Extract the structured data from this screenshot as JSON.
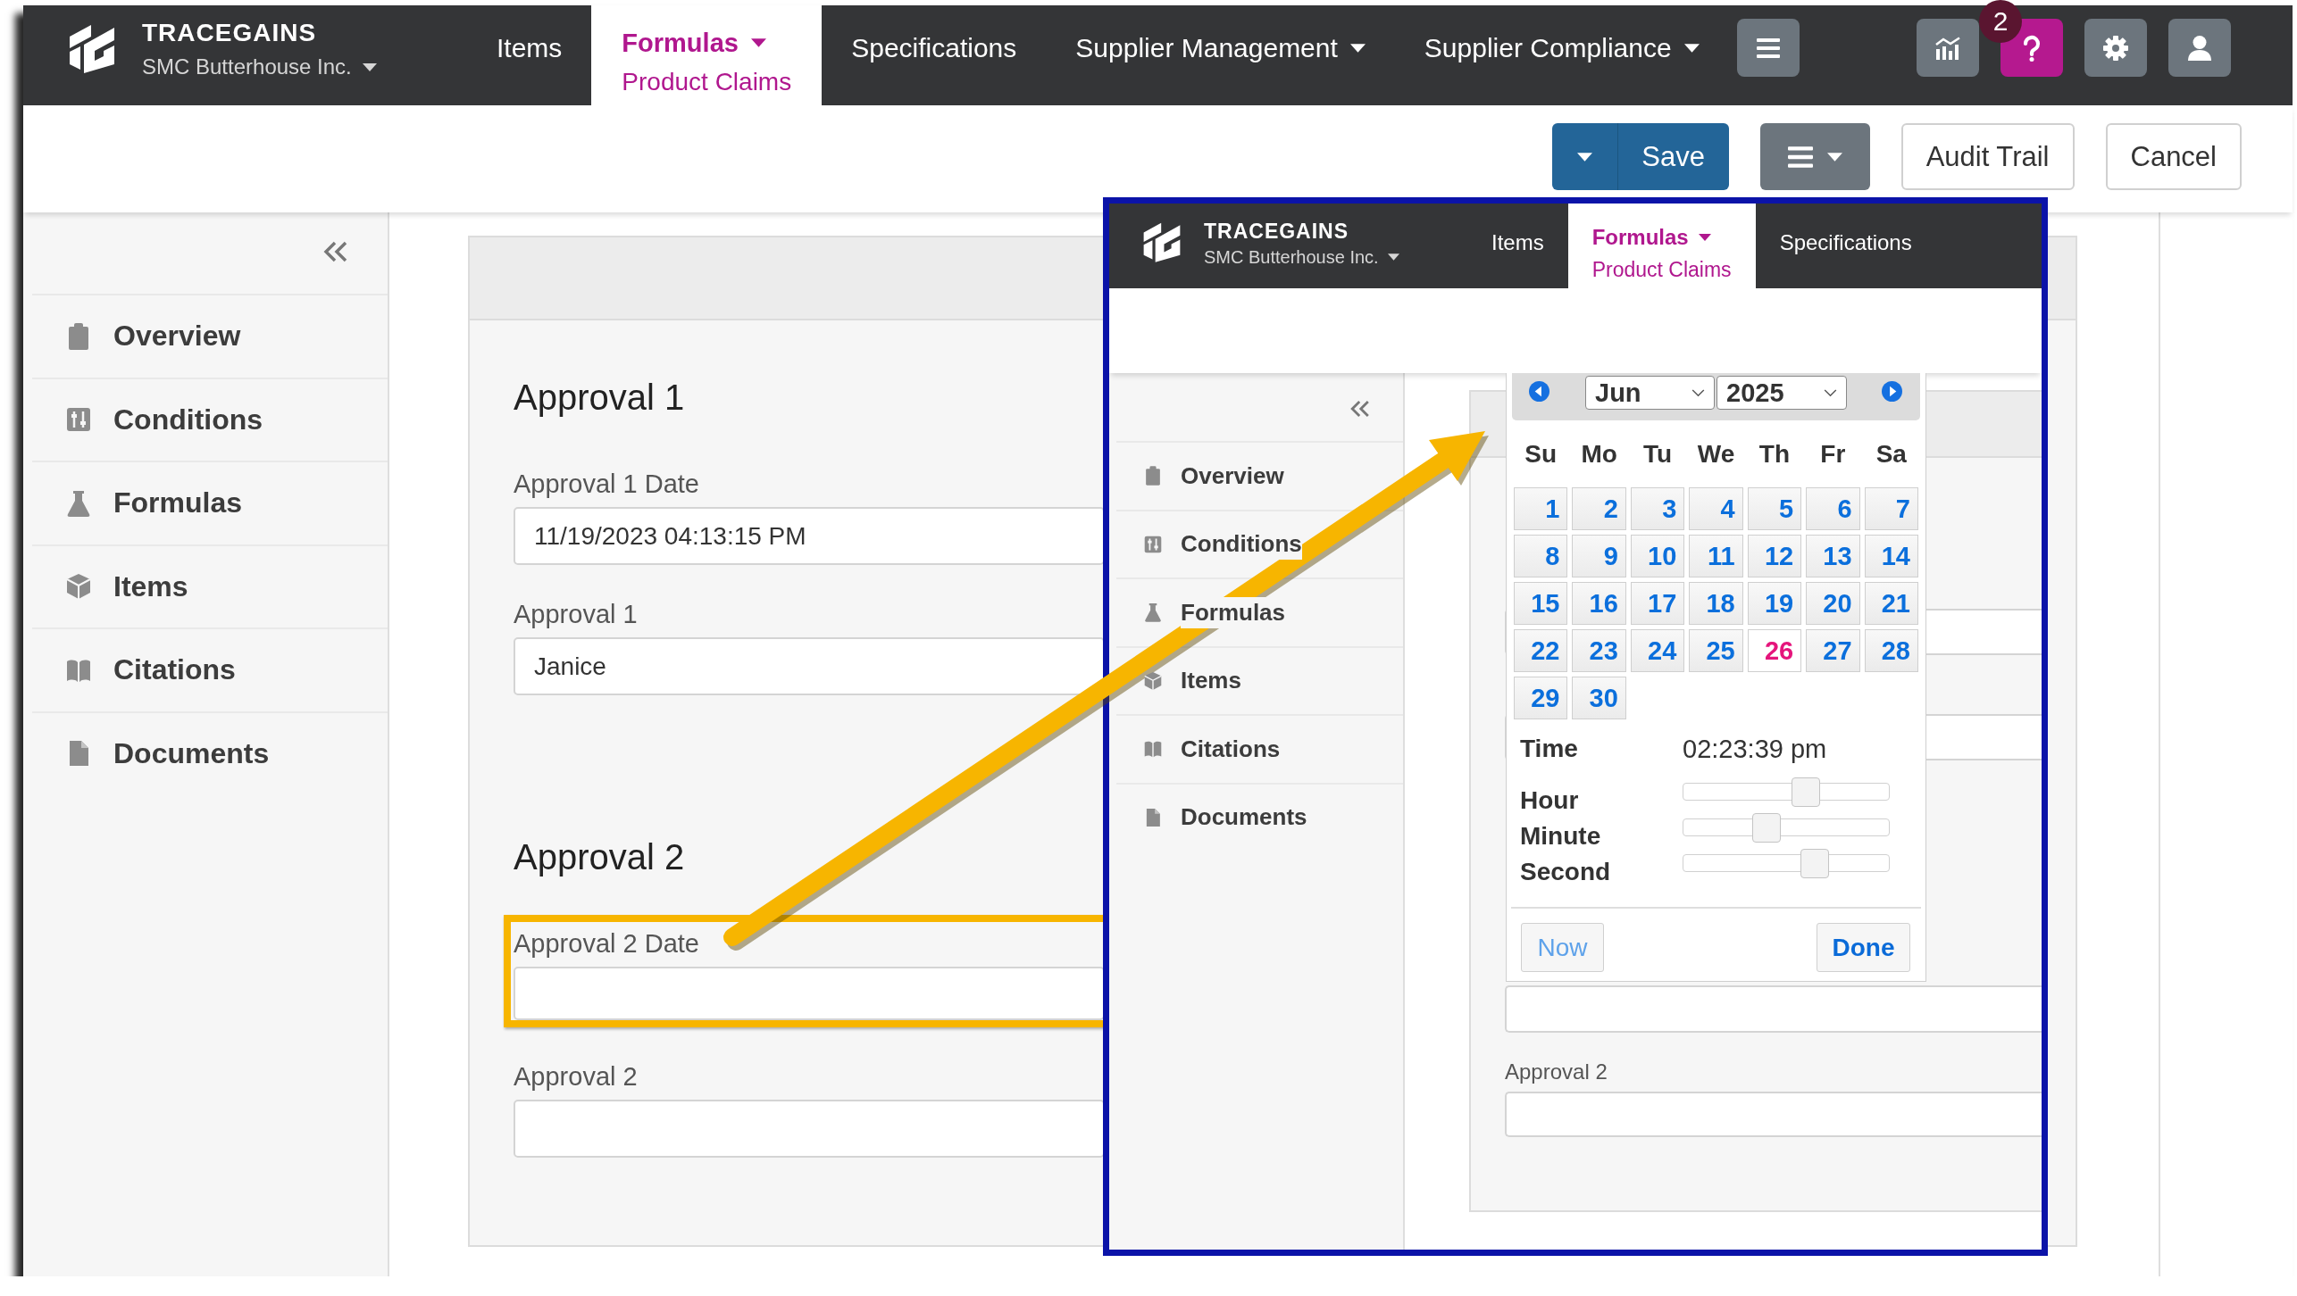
{
  "nav": {
    "brand": "TRACEGAINS",
    "organization": "SMC Butterhouse Inc.",
    "links": [
      {
        "label": "Items",
        "selected": false,
        "dropdown": false
      },
      {
        "label": "Formulas",
        "sublabel": "Product Claims",
        "selected": true,
        "dropdown": true
      },
      {
        "label": "Specifications",
        "selected": false,
        "dropdown": false
      },
      {
        "label": "Supplier Management",
        "selected": false,
        "dropdown": true
      },
      {
        "label": "Supplier Compliance",
        "selected": false,
        "dropdown": true
      }
    ],
    "icon_buttons": [
      {
        "color": "#6c757d"
      },
      {
        "color": "#b5198f",
        "badge": "2"
      },
      {
        "color": "#6c757d"
      },
      {
        "color": "#6c757d"
      }
    ]
  },
  "toolbar": {
    "buttons": [
      {
        "kind": "split",
        "label": "Save"
      },
      {
        "kind": "menu"
      },
      {
        "kind": "plain",
        "label": "Audit Trail"
      },
      {
        "kind": "plain",
        "label": "Cancel"
      }
    ]
  },
  "sidebar": {
    "items": [
      {
        "label": "Overview",
        "selected": false
      },
      {
        "label": "Conditions",
        "selected": false
      },
      {
        "label": "Formulas",
        "selected": false
      },
      {
        "label": "Items",
        "selected": false
      },
      {
        "label": "Citations",
        "selected": false
      },
      {
        "label": "Documents",
        "selected": false
      }
    ]
  },
  "form": {
    "sections": [
      {
        "title": "Approval 1",
        "fields": [
          {
            "label": "Approval 1 Date",
            "value": "11/19/2023 04:13:15 PM",
            "highlighted": false
          },
          {
            "label": "Approval 1",
            "value": "Janice",
            "highlighted": false
          }
        ]
      },
      {
        "title": "Approval 2",
        "fields": [
          {
            "label": "Approval 2 Date",
            "highlighted": true
          },
          {
            "label": "Approval 2",
            "highlighted": false
          }
        ]
      }
    ]
  },
  "inset": {
    "nav": {
      "brand": "TRACEGAINS",
      "organization": "SMC Butterhouse Inc.",
      "links": [
        {
          "label": "Items",
          "selected": false,
          "dropdown": false
        },
        {
          "label": "Formulas",
          "sublabel": "Product Claims",
          "selected": true,
          "dropdown": true
        },
        {
          "label": "Specifications",
          "selected": false,
          "dropdown": false
        }
      ]
    },
    "sidebar": {
      "items": [
        {
          "label": "Overview",
          "selected": false
        },
        {
          "label": "Conditions",
          "selected": false
        },
        {
          "label": "Formulas",
          "selected": false
        },
        {
          "label": "Items",
          "selected": false
        },
        {
          "label": "Citations",
          "selected": false
        },
        {
          "label": "Documents",
          "selected": false
        }
      ]
    },
    "datepicker": {
      "month": "Jun",
      "year": "2025",
      "weekdays": [
        "Su",
        "Mo",
        "Tu",
        "We",
        "Th",
        "Fr",
        "Sa"
      ],
      "days": [
        {
          "label": "1",
          "selected": false
        },
        {
          "label": "2",
          "selected": false
        },
        {
          "label": "3",
          "selected": false
        },
        {
          "label": "4",
          "selected": false
        },
        {
          "label": "5",
          "selected": false
        },
        {
          "label": "6",
          "selected": false
        },
        {
          "label": "7",
          "selected": false
        },
        {
          "label": "8",
          "selected": false
        },
        {
          "label": "9",
          "selected": false
        },
        {
          "label": "10",
          "selected": false
        },
        {
          "label": "11",
          "selected": false
        },
        {
          "label": "12",
          "selected": false
        },
        {
          "label": "13",
          "selected": false
        },
        {
          "label": "14",
          "selected": false
        },
        {
          "label": "15",
          "selected": false
        },
        {
          "label": "16",
          "selected": false
        },
        {
          "label": "17",
          "selected": false
        },
        {
          "label": "18",
          "selected": false
        },
        {
          "label": "19",
          "selected": false
        },
        {
          "label": "20",
          "selected": false
        },
        {
          "label": "21",
          "selected": false
        },
        {
          "label": "22",
          "selected": false
        },
        {
          "label": "23",
          "selected": false
        },
        {
          "label": "24",
          "selected": false
        },
        {
          "label": "25",
          "selected": false
        },
        {
          "label": "26",
          "selected": true
        },
        {
          "label": "27",
          "selected": false
        },
        {
          "label": "28",
          "selected": false
        },
        {
          "label": "29",
          "selected": false
        },
        {
          "label": "30",
          "selected": false
        }
      ],
      "time_label": "Time",
      "time": "02:23:39 pm",
      "sliders": [
        {
          "label": "Hour",
          "level": 0.61
        },
        {
          "label": "Minute",
          "level": 0.39
        },
        {
          "label": "Second",
          "level": 0.66
        }
      ],
      "buttons": [
        {
          "label": "Now",
          "kind": "secondary"
        },
        {
          "label": "Done",
          "kind": "primary"
        }
      ]
    },
    "form": {
      "field_label": "Approval 2"
    }
  }
}
